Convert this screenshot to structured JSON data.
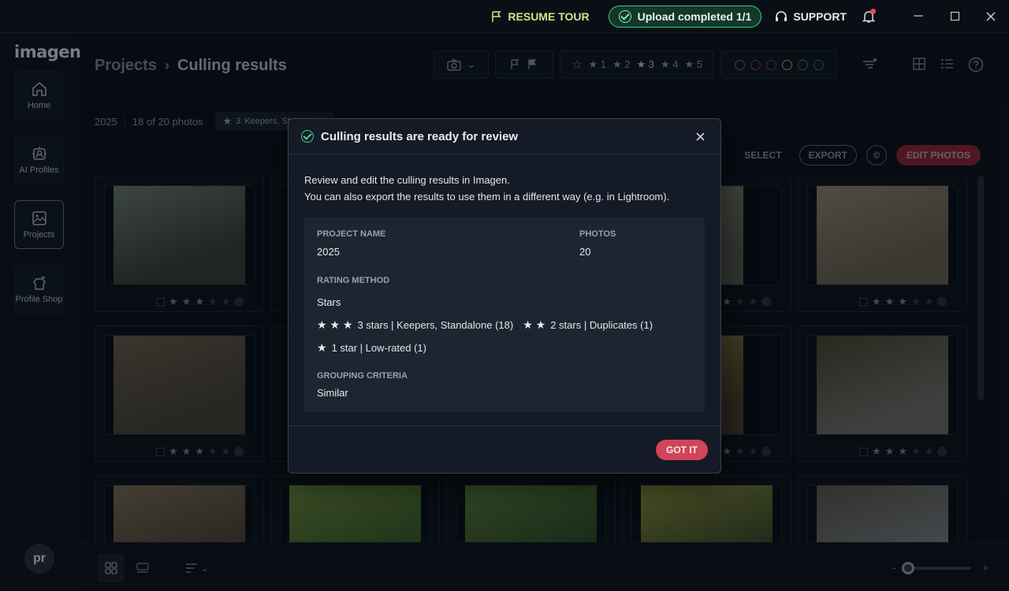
{
  "titlebar": {
    "resume_tour": "RESUME TOUR",
    "upload_status": "Upload completed 1/1",
    "support": "SUPPORT"
  },
  "sidebar": {
    "logo": "imagen",
    "items": [
      {
        "label": "Home",
        "icon": "home-icon"
      },
      {
        "label": "AI Profiles",
        "icon": "ai-profile-icon"
      },
      {
        "label": "Projects",
        "icon": "projects-icon",
        "active": true
      },
      {
        "label": "Profile Shop",
        "icon": "shop-icon"
      }
    ],
    "avatar": "pr"
  },
  "header": {
    "breadcrumb_root": "Projects",
    "breadcrumb_sep": "›",
    "breadcrumb_current": "Culling results",
    "star_filters": [
      "1",
      "2",
      "3",
      "4",
      "5"
    ],
    "color_filters": [
      "#6a6f78",
      "#8a3a6a",
      "#9a3a3a",
      "#b8b25a",
      "#3f8a4a",
      "#3a6a9a"
    ]
  },
  "subbar": {
    "project": "2025",
    "count": "18 of 20 photos",
    "chip_star": "3",
    "chip_text": "Keepers, Standalone"
  },
  "actions": {
    "select": "SELECT",
    "export": "EXPORT",
    "edit_photos": "EDIT PHOTOS"
  },
  "grid": {
    "cards": [
      {
        "img": "#3b3f38",
        "img2": "#6d7a6e",
        "stars": 3
      },
      {
        "img": "#2a2f27",
        "img2": "#484f40",
        "stars": 3
      },
      {
        "img": "#2b2f2a",
        "img2": "#4d5240",
        "stars": 3
      },
      {
        "img": "#5a5a4e",
        "img2": "#807a68",
        "stars": 3
      },
      {
        "img": "#6a6252",
        "img2": "#8e8470",
        "stars": 3
      },
      {
        "img": "#4a4336",
        "img2": "#665c4c",
        "stars": 3
      },
      {
        "img": "#2c3328",
        "img2": "#4c5538",
        "stars": 3
      },
      {
        "img": "#2c3328",
        "img2": "#4c5538",
        "stars": 3
      },
      {
        "img": "#4a3e28",
        "img2": "#7a7a3a",
        "stars": 3
      },
      {
        "img": "#6f6d66",
        "img2": "#4a4530",
        "stars": 3
      },
      {
        "img": "#4e4433",
        "img2": "#7a6a52",
        "stars": 0
      },
      {
        "img": "#3b5a28",
        "img2": "#6a8a3a",
        "stars": 0
      },
      {
        "img": "#2f4a25",
        "img2": "#5a7a3a",
        "stars": 0
      },
      {
        "img": "#3a4a28",
        "img2": "#8a8a3a",
        "stars": 0
      },
      {
        "img": "#7a7e80",
        "img2": "#5a554a",
        "stars": 0
      }
    ]
  },
  "dialog": {
    "title": "Culling results are ready for review",
    "line1": "Review and edit the culling results in Imagen.",
    "line2": "You can also export the results to use them in a different way (e.g. in Lightroom).",
    "project_name_label": "PROJECT NAME",
    "project_name": "2025",
    "photos_label": "PHOTOS",
    "photos": "20",
    "rating_method_label": "RATING METHOD",
    "rating_method": "Stars",
    "rating_3": "3 stars | Keepers, Standalone (18)",
    "rating_2": "2 stars | Duplicates (1)",
    "rating_1": "1 star | Low-rated (1)",
    "grouping_label": "GROUPING CRITERIA",
    "grouping": "Similar",
    "got_it": "GOT IT"
  },
  "zoom": {
    "minus": "-",
    "plus": "+"
  },
  "colors": {
    "accent": "#d04559",
    "upload_ok": "#3ccf7f"
  }
}
